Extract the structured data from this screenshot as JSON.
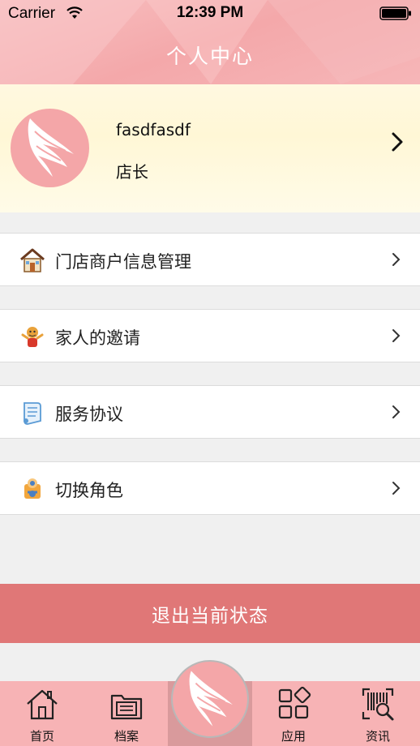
{
  "status_bar": {
    "carrier": "Carrier",
    "time": "12:39 PM"
  },
  "header": {
    "title": "个人中心"
  },
  "profile": {
    "name": "fasdfasdf",
    "role": "店长",
    "avatar_icon": "wing-logo-icon"
  },
  "menu": [
    {
      "label": "门店商户信息管理",
      "icon": "store-house-icon"
    },
    {
      "label": "家人的邀请",
      "icon": "family-figure-icon"
    },
    {
      "label": "服务协议",
      "icon": "scroll-document-icon"
    },
    {
      "label": "切换角色",
      "icon": "switch-role-icon"
    }
  ],
  "logout": {
    "label": "退出当前状态"
  },
  "tabbar": {
    "tabs": [
      {
        "label": "首页",
        "icon": "home-icon"
      },
      {
        "label": "档案",
        "icon": "folder-icon"
      },
      {
        "label": "",
        "icon": "wing-logo-icon"
      },
      {
        "label": "应用",
        "icon": "apps-grid-icon"
      },
      {
        "label": "资讯",
        "icon": "barcode-search-icon"
      }
    ]
  },
  "colors": {
    "header_pink": "#f4a8aa",
    "logout_red": "#e07777",
    "tabbar_pink": "#f7b3b5",
    "profile_cream": "#fff7d6"
  }
}
